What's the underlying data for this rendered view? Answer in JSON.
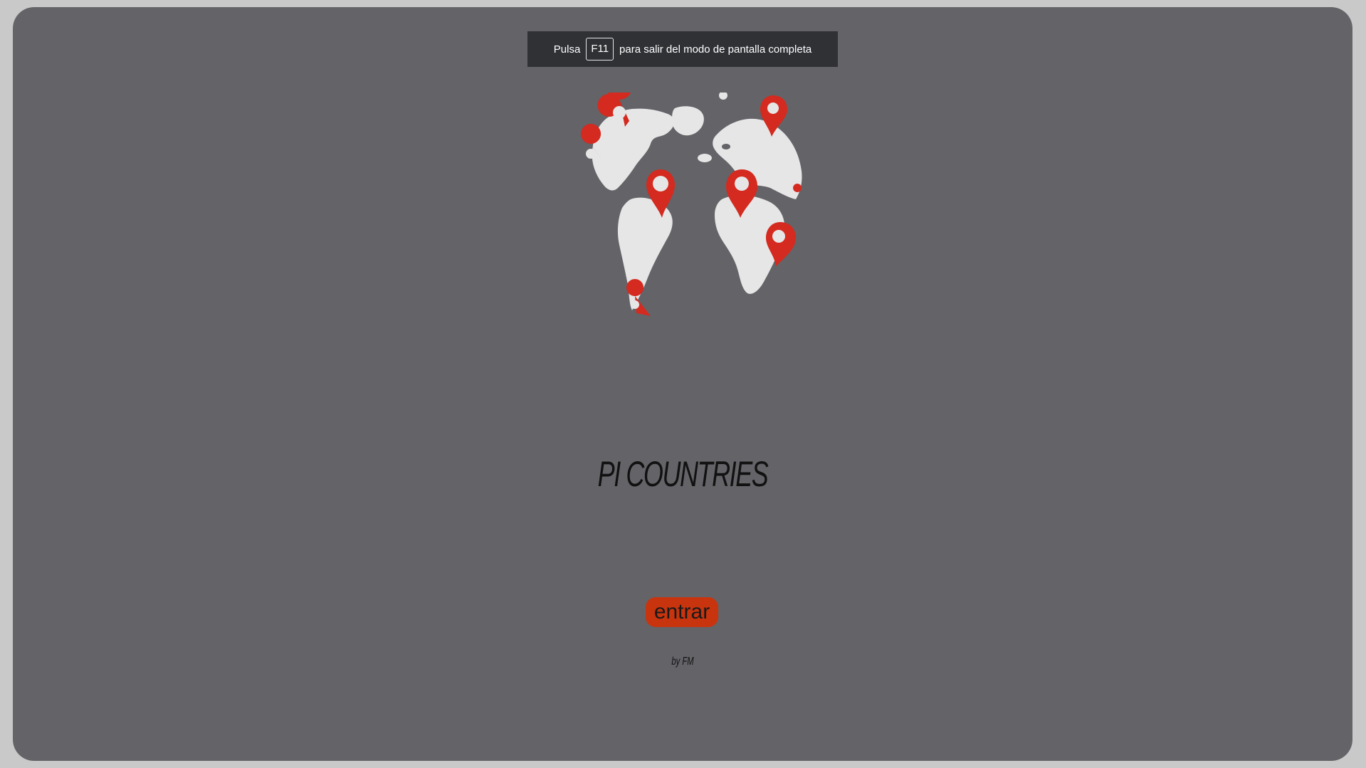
{
  "fullscreen_toast": {
    "prefix": "Pulsa",
    "key": "F11",
    "suffix": "para salir del modo de pantalla completa"
  },
  "hero": {
    "logo_icon": "globe-with-map-pins-icon",
    "title": "PI COUNTRIES"
  },
  "enter_button": {
    "label": "entrar",
    "color": "#c8340e"
  },
  "footer": {
    "byline": "by FM"
  },
  "colors": {
    "background": "#646368",
    "frame": "#c9c9c9",
    "pin": "#d42a1f",
    "land": "#e6e6e6"
  }
}
